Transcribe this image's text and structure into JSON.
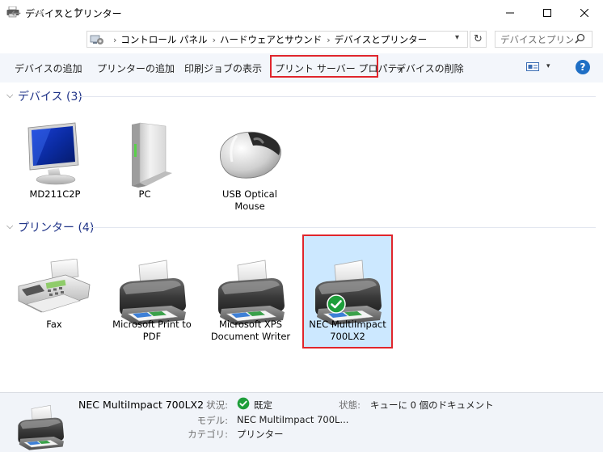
{
  "window": {
    "title": "デバイスとプリンター",
    "min_glyph": "—",
    "max_glyph": "☐",
    "close_glyph": "✕"
  },
  "nav": {
    "back_glyph": "←",
    "forward_glyph": "→",
    "recent_glyph": "⌄",
    "up_glyph": "↑",
    "breadcrumbs": [
      "コントロール パネル",
      "ハードウェアとサウンド",
      "デバイスとプリンター"
    ],
    "crumb_separator": "›",
    "dropdown_glyph": "⌄",
    "refresh_glyph": "↻",
    "search_placeholder": "デバイスとプリン...",
    "search_icon": "search-icon"
  },
  "commands": {
    "add_device": "デバイスの追加",
    "add_printer": "プリンターの追加",
    "print_jobs": "印刷ジョブの表示",
    "server_properties": "プリント サーバー プロパティ",
    "remove_device": "デバイスの削除",
    "view_dropdown": "▾",
    "help": "?"
  },
  "groups": {
    "devices": {
      "header": "デバイス (3)",
      "items": [
        {
          "label": "MD211C2P",
          "icon": "monitor-icon"
        },
        {
          "label": "PC",
          "icon": "pc-tower-icon"
        },
        {
          "label": "USB Optical Mouse",
          "icon": "mouse-icon"
        }
      ]
    },
    "printers": {
      "header": "プリンター (4)",
      "items": [
        {
          "label": "Fax",
          "icon": "fax-icon"
        },
        {
          "label": "Microsoft Print to PDF",
          "icon": "printer-icon"
        },
        {
          "label": "Microsoft XPS Document Writer",
          "icon": "printer-icon"
        },
        {
          "label": "NEC MultiImpact 700LX2",
          "icon": "printer-icon",
          "default": true,
          "selected": true
        }
      ]
    }
  },
  "statusbar": {
    "name": "NEC MultiImpact 700LX2",
    "status_label": "状況:",
    "status_value": "既定",
    "state_label": "状態:",
    "state_value": "キューに 0 個のドキュメント",
    "model_label": "モデル:",
    "model_value": "NEC MultiImpact 700L...",
    "category_label": "カテゴリ:",
    "category_value": "プリンター"
  },
  "colors": {
    "accent_highlight": "#e0252c",
    "selection": "#cce8ff",
    "group_header": "#1e3287",
    "command_bar": "#f3f6fb",
    "status_bar": "#f1f4f9",
    "help_icon": "#1f6fc5",
    "default_check": "#1e9e3a"
  }
}
